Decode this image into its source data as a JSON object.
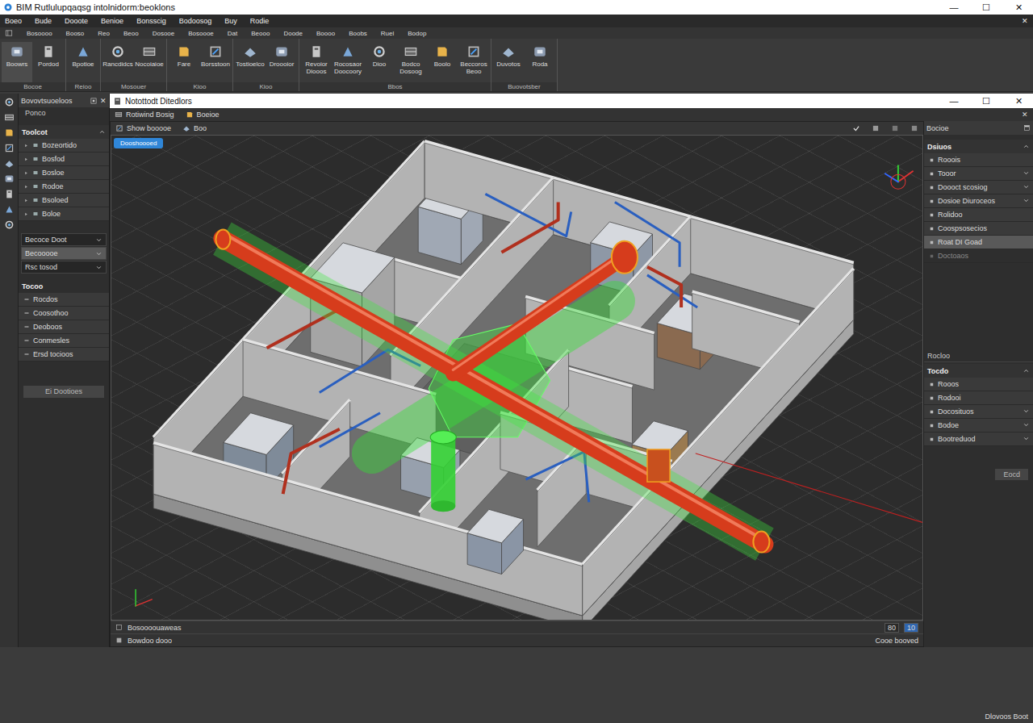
{
  "window": {
    "title": "BIM Rutlulupqaqsg intolnidorm:beoklons",
    "controls": [
      "—",
      "☐",
      "✕"
    ]
  },
  "menu": {
    "items": [
      "Boeo",
      "Bude",
      "Dooote",
      "Benioe",
      "Bonsscig",
      "Bodoosog",
      "Buy",
      "Rodie"
    ],
    "close": "✕"
  },
  "submenu": {
    "items": [
      "Bosoooo",
      "Booso",
      "Reo",
      "Beoo",
      "Dosooe",
      "Bosoooe",
      "Dat",
      "Beooo",
      "Doode",
      "Boooo",
      "Boobs",
      "Ruel",
      "Bodop"
    ]
  },
  "ribbon": {
    "groups": [
      {
        "label": "Bocoe",
        "buttons": [
          {
            "label": "Boowrs",
            "selected": true
          },
          {
            "label": "Pordod",
            "selected": false
          }
        ]
      },
      {
        "label": "Reioo",
        "buttons": [
          {
            "label": "Bpotioe",
            "selected": false
          }
        ]
      },
      {
        "label": "Mosouer",
        "buttons": [
          {
            "label": "Rancdidcs",
            "selected": false
          },
          {
            "label": "Nocoiaioe",
            "selected": false
          }
        ]
      },
      {
        "label": "Kioo",
        "buttons": [
          {
            "label": "Fare",
            "selected": false
          },
          {
            "label": "Borsstoon",
            "selected": false
          }
        ]
      },
      {
        "label": "Kioo",
        "buttons": [
          {
            "label": "Tostioelco",
            "selected": false
          },
          {
            "label": "Droooior",
            "selected": false
          }
        ]
      },
      {
        "label": "Bbos",
        "buttons": [
          {
            "label": "Revoior Diooos",
            "selected": false
          },
          {
            "label": "Rocosaor Doocoory",
            "selected": false
          },
          {
            "label": "Dioo",
            "selected": false
          },
          {
            "label": "Bodco Dosoog",
            "selected": false
          },
          {
            "label": "Boolo",
            "selected": false
          },
          {
            "label": "Beccoros Beoo",
            "selected": false
          }
        ]
      },
      {
        "label": "Buovotsber",
        "buttons": [
          {
            "label": "Duvotos",
            "selected": false
          },
          {
            "label": "Roda",
            "selected": false
          }
        ]
      }
    ]
  },
  "left_panel": {
    "title": "Bovovtsuoeloos",
    "close": "✕",
    "subtitle": "Ponco",
    "tree": {
      "title": "Toolcot",
      "expanded": true,
      "items": [
        "Bozeortido",
        "Bosfod",
        "Bosloe",
        "Rodoe",
        "Bsoloed",
        "Boloe"
      ]
    },
    "fields": [
      {
        "label": "Becoce Doot",
        "selected": false
      },
      {
        "label": "Becooooe",
        "selected": true
      },
      {
        "label": "Rsc tosod",
        "selected": false
      }
    ],
    "tools": {
      "title": "Tocoo",
      "items": [
        "Rocdos",
        "Coosothoo",
        "Deoboos",
        "Conmesles",
        "Ersd tocioos"
      ]
    },
    "button": "Ei Dootioes"
  },
  "document": {
    "title": "Notottodt Ditedlors",
    "controls": [
      "—",
      "☐",
      "✕"
    ],
    "close": "✕",
    "toolbar": [
      "Rotiwind Bosig",
      "Boeioe"
    ],
    "view_bar": [
      "Show booooe",
      "Boo"
    ],
    "view_tag": "Dooshoooed",
    "status": {
      "left": [
        "Bosoooouaweas",
        "Bowdoo dooo"
      ],
      "right": "Cooe booved",
      "counters": [
        {
          "label": "80",
          "selected": false
        },
        {
          "label": "10",
          "selected": true
        }
      ]
    }
  },
  "right_panel": {
    "title": "Bocioe",
    "sections": [
      {
        "title": "Dsiuos",
        "expanded": true,
        "items": [
          {
            "label": "Rooois",
            "kind": "plain",
            "selected": false,
            "disabled": false
          },
          {
            "label": "Tooor",
            "kind": "dropdown",
            "selected": false,
            "disabled": false
          },
          {
            "label": "Doooct scosiog",
            "kind": "dropdown",
            "selected": false,
            "disabled": false
          },
          {
            "label": "Dosioe Diuroceos",
            "kind": "dropdown",
            "selected": false,
            "disabled": false
          },
          {
            "label": "Rolidoo",
            "kind": "plain",
            "selected": false,
            "disabled": false
          },
          {
            "label": "Coospsosecios",
            "kind": "plain",
            "selected": false,
            "disabled": false
          },
          {
            "label": "Roat DI Goad",
            "kind": "plain",
            "selected": true,
            "disabled": false
          },
          {
            "label": "Doctoaos",
            "kind": "plain",
            "selected": false,
            "disabled": true
          }
        ]
      },
      {
        "title": "Tocdo",
        "expanded": true,
        "items": [
          {
            "label": "Rooos",
            "kind": "plain",
            "selected": false,
            "disabled": false
          },
          {
            "label": "Rodooi",
            "kind": "plain",
            "selected": false,
            "disabled": false
          },
          {
            "label": "Docosituos",
            "kind": "dropdown",
            "selected": false,
            "disabled": false
          },
          {
            "label": "Bodoe",
            "kind": "dropdown",
            "selected": false,
            "disabled": false
          },
          {
            "label": "Bootreduod",
            "kind": "dropdown",
            "selected": false,
            "disabled": false
          }
        ]
      }
    ],
    "label": "Rocloo",
    "button": "Eocd"
  },
  "footer": "Dlovoos Boot"
}
